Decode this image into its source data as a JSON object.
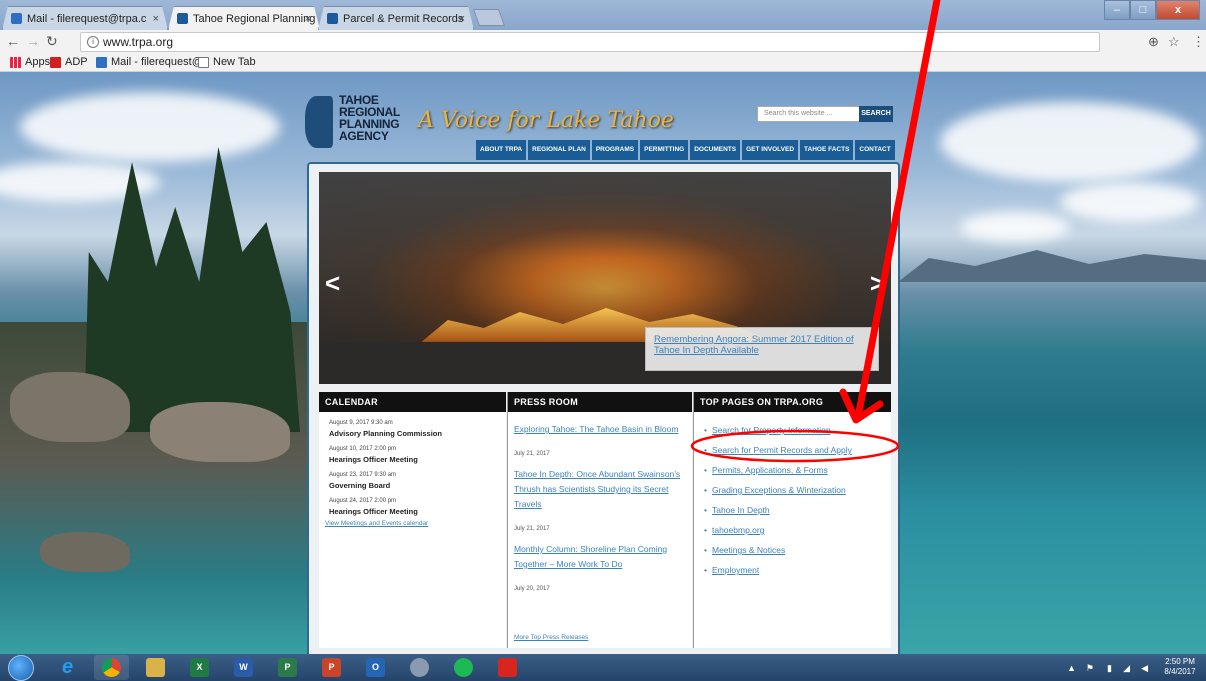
{
  "browser": {
    "tabs": [
      {
        "label": "Mail - filerequest@trpa.c",
        "favicon_color": "#2f6fc2"
      },
      {
        "label": "Tahoe Regional Planning",
        "favicon_color": "#1d5a9a"
      },
      {
        "label": "Parcel & Permit Records",
        "favicon_color": "#1d5a9a"
      }
    ],
    "tab_close": "×",
    "url": "www.trpa.org",
    "bookmarks": [
      {
        "label": "Apps",
        "icon": "apps-grid-icon"
      },
      {
        "label": "ADP",
        "icon": "adp-icon"
      },
      {
        "label": "Mail - filerequest@t",
        "icon": "outlook-icon"
      },
      {
        "label": "New Tab",
        "icon": "page-icon"
      }
    ]
  },
  "site": {
    "logo_lines": [
      "TAHOE",
      "REGIONAL",
      "PLANNING",
      "AGENCY"
    ],
    "tagline": "A Voice for Lake Tahoe",
    "search_placeholder": "Search this website ...",
    "search_button": "SEARCH",
    "nav": [
      "ABOUT TRPA",
      "REGIONAL PLAN",
      "PROGRAMS",
      "PERMITTING",
      "DOCUMENTS",
      "GET INVOLVED",
      "TAHOE FACTS",
      "CONTACT"
    ],
    "hero_caption": "Remembering Angora: Summer 2017 Edition of Tahoe In Depth Available",
    "calendar": {
      "heading": "CALENDAR",
      "events": [
        {
          "date": "August 9, 2017 9:30 am",
          "title": "Advisory Planning Commission"
        },
        {
          "date": "August 10, 2017 2:00 pm",
          "title": "Hearings Officer Meeting"
        },
        {
          "date": "August 23, 2017 9:30 am",
          "title": "Governing Board"
        },
        {
          "date": "August 24, 2017 2:00 pm",
          "title": "Hearings Officer Meeting"
        }
      ],
      "more": "View Meetings and Events calendar"
    },
    "press": {
      "heading": "PRESS ROOM",
      "items": [
        {
          "title": "Exploring Tahoe: The Tahoe Basin in Bloom",
          "date": "July 21, 2017"
        },
        {
          "title": "Tahoe In Depth: Once Abundant Swainson’s Thrush has Scientists Studying its Secret Travels",
          "date": "July 21, 2017"
        },
        {
          "title": "Monthly Column: Shoreline Plan Coming Together – More Work To Do",
          "date": "July 20, 2017"
        }
      ],
      "more": "More Top Press Releases"
    },
    "top_pages": {
      "heading": "TOP PAGES ON TRPA.ORG",
      "links": [
        "Search for Property Information",
        "Search for Permit Records and Apply",
        "Permits, Applications, & Forms",
        "Grading Exceptions & Winterization",
        "Tahoe In Depth",
        "tahoebmp.org",
        "Meetings & Notices",
        "Employment"
      ]
    }
  },
  "annotation_color": "#ff0000",
  "taskbar": {
    "apps": [
      {
        "icon": "internet-explorer-icon",
        "glyph": "e",
        "color": "#1f7fd6"
      },
      {
        "icon": "chrome-icon",
        "glyph": "",
        "color": "#e8b21a"
      },
      {
        "icon": "file-explorer-icon",
        "glyph": "",
        "color": "#d9b24a"
      },
      {
        "icon": "excel-icon",
        "glyph": "X",
        "color": "#1f7a44"
      },
      {
        "icon": "word-icon",
        "glyph": "W",
        "color": "#2a5ca8"
      },
      {
        "icon": "project-icon",
        "glyph": "P",
        "color": "#2c7a4a"
      },
      {
        "icon": "powerpoint-icon",
        "glyph": "P",
        "color": "#c8452a"
      },
      {
        "icon": "outlook-icon",
        "glyph": "O",
        "color": "#2466b5"
      },
      {
        "icon": "snipping-tool-icon",
        "glyph": "",
        "color": "#8a9ab0"
      },
      {
        "icon": "spotify-icon",
        "glyph": "",
        "color": "#1db954"
      },
      {
        "icon": "acrobat-icon",
        "glyph": "",
        "color": "#d8251d"
      }
    ],
    "time": "2:50 PM",
    "date": "8/4/2017"
  }
}
